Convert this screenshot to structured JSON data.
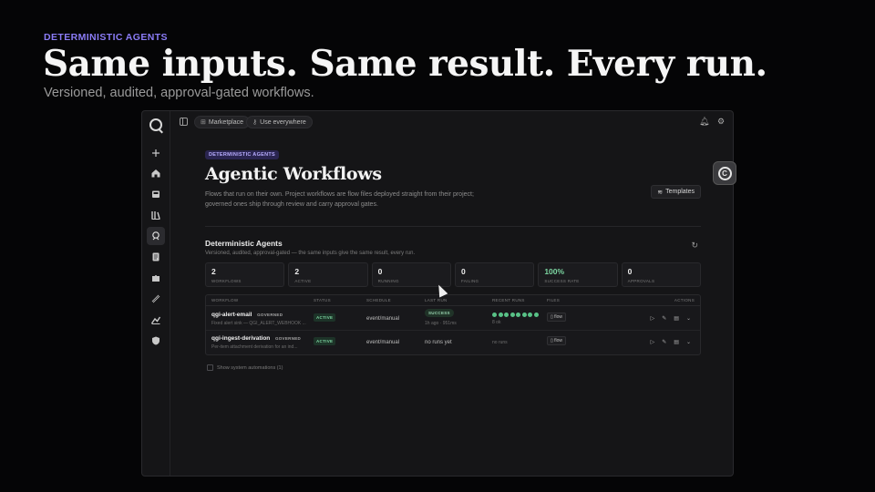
{
  "hero": {
    "eyebrow": "DETERMINISTIC AGENTS",
    "title": "Same inputs. Same result. Every run.",
    "subtitle": "Versioned, audited, approval-gated workflows."
  },
  "topbar": {
    "marketplace_label": "Marketplace",
    "use_everywhere_label": "Use everywhere"
  },
  "rail": {
    "items": [
      {
        "icon": "plus-icon"
      },
      {
        "icon": "home-icon"
      },
      {
        "icon": "inbox-icon"
      },
      {
        "icon": "library-icon"
      },
      {
        "icon": "agent-icon",
        "active": true
      },
      {
        "icon": "document-icon"
      },
      {
        "icon": "puzzle-icon"
      },
      {
        "icon": "link-icon"
      },
      {
        "icon": "graph-icon"
      },
      {
        "icon": "shield-icon"
      }
    ]
  },
  "page": {
    "badge": "DETERMINISTIC AGENTS",
    "title": "Agentic Workflows",
    "description": "Flows that run on their own. Project workflows are flow files deployed straight from their project; governed ones ship through review and carry approval gates.",
    "templates_label": "Templates"
  },
  "section": {
    "title": "Deterministic Agents",
    "subtitle": "Versioned, audited, approval-gated — the same inputs give the same result, every run."
  },
  "stats": [
    {
      "value": "2",
      "label": "WORKFLOWS"
    },
    {
      "value": "2",
      "label": "ACTIVE"
    },
    {
      "value": "0",
      "label": "RUNNING"
    },
    {
      "value": "0",
      "label": "FAILING"
    },
    {
      "value": "100%",
      "label": "SUCCESS RATE"
    },
    {
      "value": "0",
      "label": "APPROVALS"
    }
  ],
  "table": {
    "headers": {
      "workflow": "WORKFLOW",
      "status": "STATUS",
      "schedule": "SCHEDULE",
      "last_run": "LAST RUN",
      "recent_runs": "RECENT RUNS",
      "files": "FILES",
      "actions": "ACTIONS"
    },
    "rows": [
      {
        "name": "qgi-alert-email",
        "tag": "GOVERNED",
        "description": "Fixed alert sink — QGI_ALERT_WEBHOOK ...",
        "status": "ACTIVE",
        "schedule": "event/manual",
        "last_run_status": "SUCCESS",
        "last_run_meta": "1h ago · 951ms",
        "recent_runs_count": 8,
        "recent_runs_label": "8 ok",
        "file": "flow"
      },
      {
        "name": "qgi-ingest-derivation",
        "tag": "GOVERNED",
        "description": "Per-item attachment derivation for an ind...",
        "status": "ACTIVE",
        "schedule": "event/manual",
        "last_run_text": "no runs yet",
        "recent_runs_label": "no runs",
        "file": "flow"
      }
    ]
  },
  "footer": {
    "show_system_label": "Show system automations (1)"
  },
  "colors": {
    "accent": "#8b7cf6",
    "success": "#58c287",
    "background": "#050506",
    "window": "#151517"
  }
}
